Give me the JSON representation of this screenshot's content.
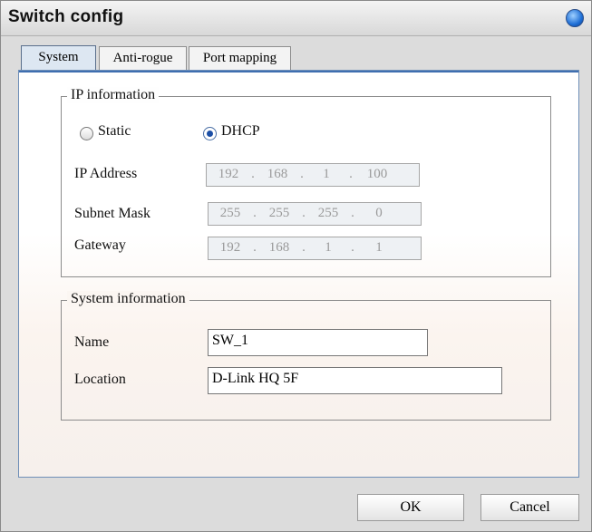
{
  "window": {
    "title": "Switch config",
    "orb_icon": "globe-icon"
  },
  "tabs": [
    {
      "label": "System",
      "active": true
    },
    {
      "label": "Anti-rogue",
      "active": false
    },
    {
      "label": "Port mapping",
      "active": false
    }
  ],
  "ip_info": {
    "legend": "IP information",
    "mode_options": [
      {
        "label": "Static",
        "selected": false
      },
      {
        "label": "DHCP",
        "selected": true
      }
    ],
    "ip_address": {
      "label": "IP Address",
      "octets": [
        "192",
        "168",
        "1",
        "100"
      ],
      "disabled": true
    },
    "subnet_mask": {
      "label": "Subnet Mask",
      "octets": [
        "255",
        "255",
        "255",
        "0"
      ],
      "disabled": true
    },
    "gateway": {
      "label": "Gateway",
      "octets": [
        "192",
        "168",
        "1",
        "1"
      ],
      "disabled": true
    }
  },
  "system_info": {
    "legend": "System information",
    "name": {
      "label": "Name",
      "value": "SW_1"
    },
    "location": {
      "label": "Location",
      "value": "D-Link HQ 5F"
    }
  },
  "buttons": {
    "ok": "OK",
    "cancel": "Cancel"
  }
}
